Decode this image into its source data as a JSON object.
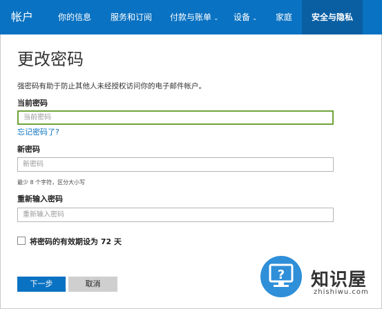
{
  "nav": {
    "brand": "帐户",
    "items": [
      {
        "label": "你的信息",
        "chevron": false,
        "active": false
      },
      {
        "label": "服务和订阅",
        "chevron": false,
        "active": false
      },
      {
        "label": "付款与账单",
        "chevron": true,
        "active": false
      },
      {
        "label": "设备",
        "chevron": true,
        "active": false
      },
      {
        "label": "家庭",
        "chevron": false,
        "active": false
      },
      {
        "label": "安全与隐私",
        "chevron": false,
        "active": true
      }
    ]
  },
  "page": {
    "title": "更改密码",
    "description": "强密码有助于防止其他人未经授权访问你的电子邮件帐户。"
  },
  "current_password": {
    "label": "当前密码",
    "placeholder": "当前密码",
    "forgot_link": "忘记密码了?"
  },
  "new_password": {
    "label": "新密码",
    "placeholder": "新密码",
    "hint": "最少 8 个字符，区分大小写"
  },
  "confirm_password": {
    "label": "重新输入密码",
    "placeholder": "重新输入密码"
  },
  "expiry": {
    "label": "将密码的有效期设为 72 天",
    "checked": false
  },
  "buttons": {
    "next": "下一步",
    "cancel": "取消"
  },
  "watermark": {
    "text": "知识屋",
    "subtext": "zhishiwu.com"
  },
  "colors": {
    "nav_bg": "#0a72c2",
    "nav_active_bg": "#0a5fa3",
    "focus_border": "#6ea33a",
    "link": "#0a72c2",
    "primary_button": "#0a72c2",
    "secondary_button": "#cfcfcf"
  },
  "icons": {
    "chevron": "chevron-down-icon",
    "watermark_logo": "computer-question-icon"
  }
}
